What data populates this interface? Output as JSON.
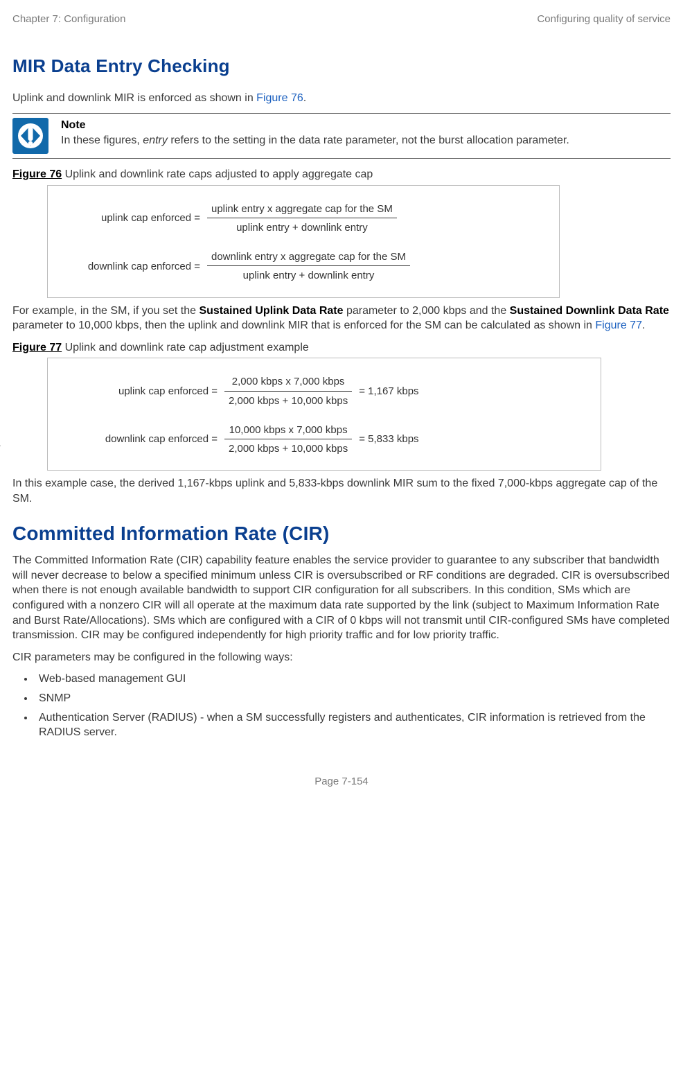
{
  "header": {
    "left": "Chapter 7:  Configuration",
    "right": "Configuring quality of service"
  },
  "h_mir": "MIR Data Entry Checking",
  "p_intro_a": "Uplink and downlink MIR is enforced as shown in ",
  "p_intro_link": "Figure 76",
  "p_intro_b": ".",
  "note": {
    "title": "Note",
    "body_a": "In these figures, ",
    "body_em": "entry",
    "body_b": " refers to the setting in the data rate parameter, not the burst allocation parameter."
  },
  "fig76": {
    "label": "Figure 76",
    "caption": " Uplink and downlink rate caps adjusted to apply aggregate cap",
    "r1_lhs": "uplink cap  enforced   =",
    "r1_num": "uplink entry  x  aggregate cap for the SM",
    "r1_den": "uplink entry  +   downlink entry",
    "r2_lhs": "downlink cap enforced  =",
    "r2_num": "downlink entry  x  aggregate cap for the SM",
    "r2_den": "uplink entry  +   downlink entry"
  },
  "p_example_a": "For example, in the SM, if you set the ",
  "p_example_s1": "Sustained Uplink Data Rate",
  "p_example_b": " parameter to 2,000 kbps and the ",
  "p_example_s2": "Sustained Downlink Data Rate",
  "p_example_c": " parameter to 10,000 kbps, then the uplink and downlink MIR that is enforced for the SM can be calculated as shown in ",
  "p_example_link": "Figure 77",
  "p_example_d": ".",
  "fig77": {
    "label": "Figure 77",
    "caption": " Uplink and downlink rate cap adjustment example",
    "r1_lhs": "uplink cap enforced   =",
    "r1_num": "2,000 kbps  x  7,000 kbps",
    "r1_den": "2,000 kbps  +   10,000 kbps",
    "r1_rhs": "=   1,167 kbps",
    "r2_lhs_tick": "`",
    "r2_lhs": "downlink cap enforced   =",
    "r2_num": "10,000 kbps  x  7,000 kbps",
    "r2_den": "2,000 kbps  +   10,000 kbps",
    "r2_rhs": "=    5,833 kbps"
  },
  "p_case": "In this example case, the derived 1,167-kbps uplink and 5,833-kbps downlink MIR sum to the fixed 7,000-kbps aggregate cap of the SM.",
  "h_cir": "Committed Information Rate (CIR)",
  "p_cir1": "The Committed Information Rate (CIR) capability feature enables the service provider to guarantee to any subscriber that bandwidth will never decrease to below a specified minimum unless CIR is oversubscribed or RF conditions are degraded.  CIR is oversubscribed when there is not enough available bandwidth to support CIR configuration for all subscribers.  In this condition, SMs which are configured with a nonzero CIR will all operate at the maximum data rate supported by the link (subject to Maximum Information Rate and Burst Rate/Allocations).  SMs which are configured with a CIR of 0 kbps will not transmit until CIR-configured SMs have completed transmission.  CIR may be configured independently for high priority traffic and for low priority traffic.",
  "p_cir2": "CIR parameters may be configured in the following ways:",
  "bullets": {
    "b1": "Web-based management GUI",
    "b2": "SNMP",
    "b3": "Authentication Server (RADIUS) - when a SM successfully registers and authenticates, CIR information is retrieved from the RADIUS server."
  },
  "footer": "Page 7-154"
}
